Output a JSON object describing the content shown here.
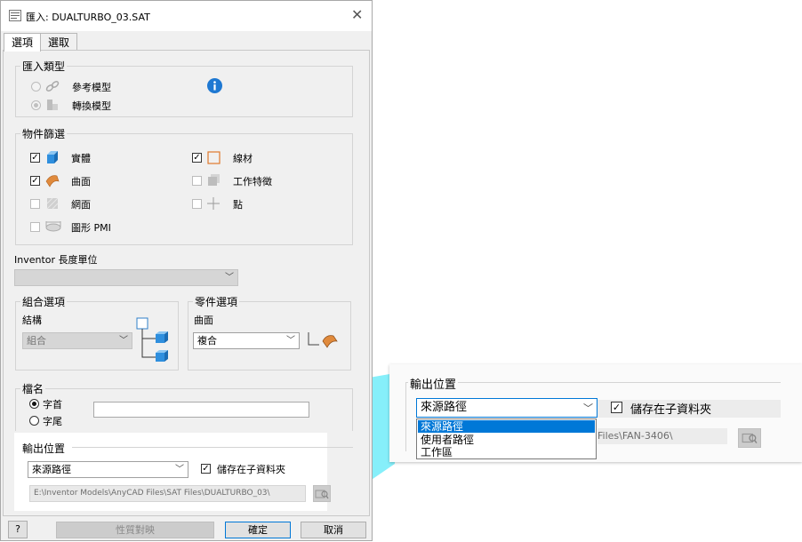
{
  "window": {
    "title": "匯入: DUALTURBO_03.SAT"
  },
  "tabs": [
    {
      "label": "選項"
    },
    {
      "label": "選取"
    }
  ],
  "import_type": {
    "group_label": "匯入類型",
    "options": [
      {
        "label": "參考模型"
      },
      {
        "label": "轉換模型"
      }
    ]
  },
  "object_filter": {
    "group_label": "物件篩選",
    "items": [
      {
        "label": "實體",
        "checked": true
      },
      {
        "label": "曲面",
        "checked": true
      },
      {
        "label": "網面",
        "checked": false
      },
      {
        "label": "圖形 PMI",
        "checked": false
      },
      {
        "label": "線材",
        "checked": true
      },
      {
        "label": "工作特徵",
        "checked": false
      },
      {
        "label": "點",
        "checked": false
      }
    ]
  },
  "length_unit": {
    "label": "Inventor 長度單位",
    "value": ""
  },
  "assembly_options": {
    "group_label": "組合選項",
    "structure_label": "結構",
    "structure_value": "組合"
  },
  "part_options": {
    "group_label": "零件選項",
    "surface_label": "曲面",
    "surface_value": "複合"
  },
  "filename": {
    "group_label": "檔名",
    "options": [
      {
        "label": "字首",
        "selected": true
      },
      {
        "label": "字尾",
        "selected": false
      }
    ],
    "value": ""
  },
  "output": {
    "group_label": "輸出位置",
    "location_value": "來源路徑",
    "save_subfolder_label": "儲存在子資料夾",
    "save_subfolder_checked": true,
    "path": "E:\\Inventor Models\\AnyCAD Files\\SAT Files\\DUALTURBO_03\\"
  },
  "footer": {
    "help_label": "?",
    "mapping_label": "性質對映",
    "ok_label": "確定",
    "cancel_label": "取消"
  },
  "callout": {
    "group_label": "輸出位置",
    "select_value": "來源路徑",
    "save_subfolder_label": "儲存在子資料夾",
    "options": [
      "來源路徑",
      "使用者路徑",
      "工作區"
    ],
    "path_fragment": "Files\\FAN-3406\\"
  },
  "colors": {
    "accent": "#0078d7",
    "callout_band": "#80eefa",
    "info_icon": "#1e78d2"
  }
}
